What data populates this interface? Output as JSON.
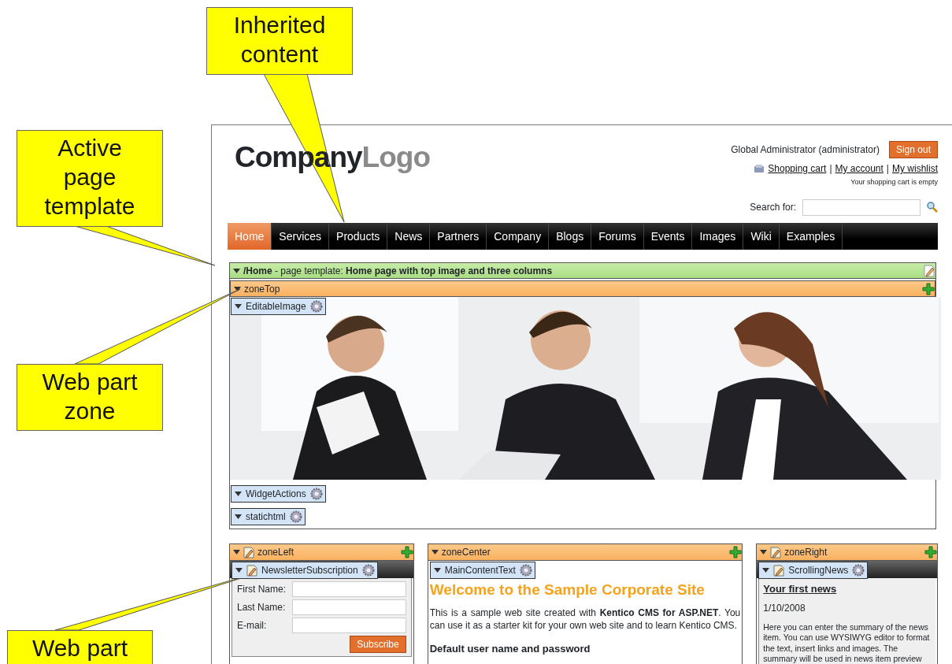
{
  "callouts": [
    {
      "text": "Inherited content"
    },
    {
      "text": "Active page template"
    },
    {
      "text": "Web part zone"
    },
    {
      "text": "Web part"
    }
  ],
  "header": {
    "logo_dark": "Company",
    "logo_light": "Logo",
    "user": "Global Administrator (administrator)",
    "sign_out": "Sign out",
    "links": [
      {
        "kind": "link",
        "label": "Shopping cart"
      },
      {
        "kind": "separator",
        "label": "|"
      },
      {
        "kind": "link",
        "label": "My account"
      },
      {
        "kind": "separator",
        "label": "|"
      },
      {
        "kind": "link",
        "label": "My wishlist"
      }
    ],
    "cart_status": "Your shopping cart is empty",
    "search_label": "Search for:"
  },
  "nav": [
    {
      "label": "Home",
      "selected": true
    },
    {
      "label": "Services",
      "selected": false
    },
    {
      "label": "Products",
      "selected": false
    },
    {
      "label": "News",
      "selected": false
    },
    {
      "label": "Partners",
      "selected": false
    },
    {
      "label": "Company",
      "selected": false
    },
    {
      "label": "Blogs",
      "selected": false
    },
    {
      "label": "Forums",
      "selected": false
    },
    {
      "label": "Events",
      "selected": false
    },
    {
      "label": "Images",
      "selected": false
    },
    {
      "label": "Wiki",
      "selected": false
    },
    {
      "label": "Examples",
      "selected": false
    }
  ],
  "template_bar": {
    "text": "**/Home** - page template: **Home page with top image and three columns**"
  },
  "top_zone": {
    "name": "zoneTop",
    "image_webpart": "EditableImage",
    "webparts": [
      {
        "name": "WidgetActions"
      },
      {
        "name": "statichtml"
      }
    ]
  },
  "columns": [
    {
      "zone": "zoneLeft",
      "icon": true,
      "webpart": "NewsletterSubscription",
      "webpart_icon": true,
      "kind": "form",
      "fields": [
        {
          "label": "First Name:"
        },
        {
          "label": "Last Name:"
        },
        {
          "label": "E-mail:"
        }
      ],
      "button": "Subscribe"
    },
    {
      "zone": "zoneCenter",
      "icon": false,
      "webpart": "MainContentText",
      "webpart_icon": false,
      "kind": "text",
      "heading": "Welcome to the Sample Corporate Site",
      "paragraph": "This is a sample web site created with **Kentico CMS for ASP.NET**. You can use it as a starter kit for your own web site and to learn Kentico CMS.",
      "subheading": "Default user name and password"
    },
    {
      "zone": "zoneRight",
      "icon": true,
      "webpart": "ScrollingNews",
      "webpart_icon": true,
      "kind": "news",
      "title": "Your first news",
      "date": "1/10/2008",
      "summary": "Here you can enter the summary of the news item. You can use WYSIWYG editor to format the text, insert links and images. The summary will be used in news item preview"
    }
  ]
}
